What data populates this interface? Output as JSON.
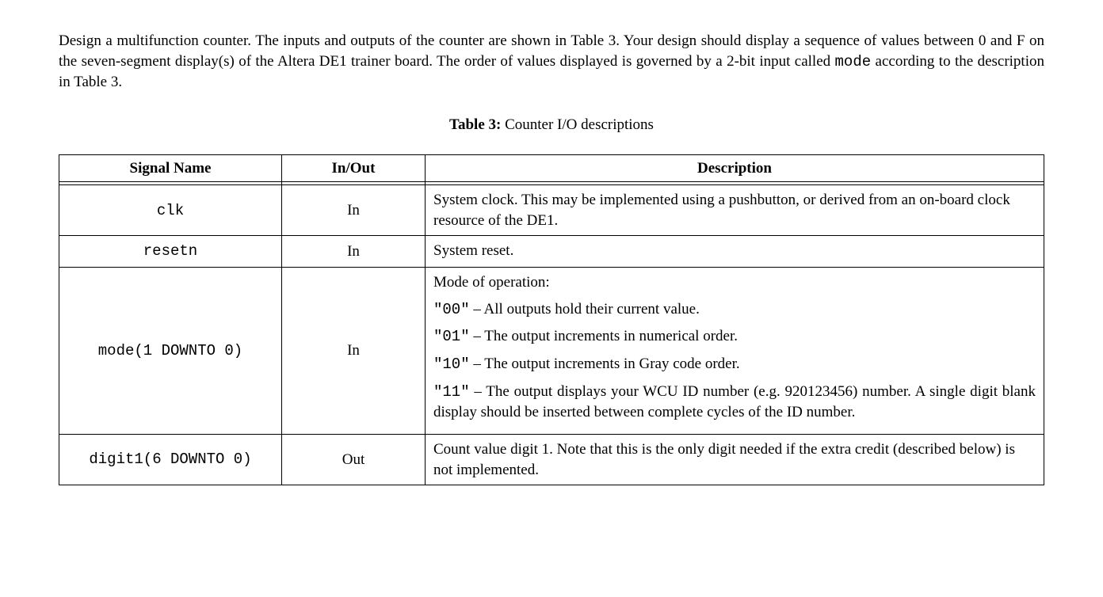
{
  "intro": {
    "p1_a": "Design a multifunction counter. The inputs and outputs of the counter are shown in Table 3. Your design should display a sequence of values between 0 and F on the seven-segment display(s) of the Altera DE1 trainer board. The order of values displayed is governed by a 2-bit input called ",
    "p1_mode": "mode",
    "p1_b": " according to the description in Table 3."
  },
  "caption": {
    "label": "Table 3:",
    "text": " Counter I/O descriptions"
  },
  "headers": {
    "signal": "Signal Name",
    "io": "In/Out",
    "desc": "Description"
  },
  "rows": {
    "clk": {
      "name": "clk",
      "io": "In",
      "desc": "System clock. This may be implemented using a pushbutton, or derived from an on-board clock resource of the DE1."
    },
    "resetn": {
      "name": "resetn",
      "io": "In",
      "desc": "System reset."
    },
    "mode": {
      "name": "mode(1 DOWNTO 0)",
      "io": "In",
      "desc_lead": "Mode of operation:",
      "m00_code": "\"00\"",
      "m00_text": " – All outputs hold their current value.",
      "m01_code": "\"01\"",
      "m01_text": " – The output increments in numerical order.",
      "m10_code": "\"10\"",
      "m10_text": " – The output increments in Gray code order.",
      "m11_code": "\"11\"",
      "m11_text": " – The output displays your WCU ID number (e.g. 920123456) number. A single digit blank display should be inserted between complete cycles of the ID number."
    },
    "digit1": {
      "name": "digit1(6 DOWNTO 0)",
      "io": "Out",
      "desc": "Count value digit 1. Note that this is the only digit needed if the extra credit (described below) is not implemented."
    }
  }
}
